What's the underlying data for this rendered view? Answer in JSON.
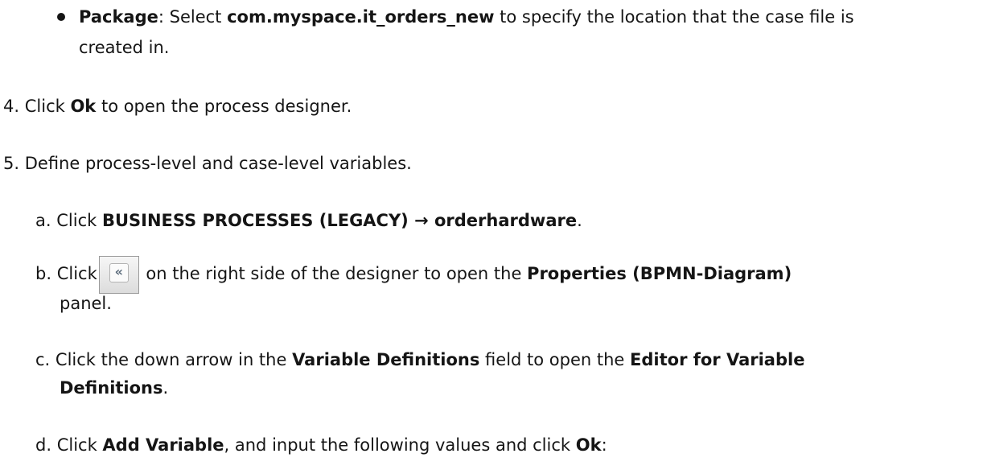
{
  "bullet_package": {
    "label": "Package",
    "text_a": ": Select ",
    "value": "com.myspace.it_orders_new",
    "text_b": " to specify the location that the case file is",
    "text_c": "created in."
  },
  "step4": {
    "number": "4.",
    "text_a": "Click ",
    "button": "Ok",
    "text_b": " to open the process designer."
  },
  "step5": {
    "number": "5.",
    "text": "Define process-level and case-level variables."
  },
  "substep_a": {
    "letter": "a.",
    "text_a": "Click ",
    "menu_path": "BUSINESS PROCESSES (LEGACY) → orderhardware",
    "text_b": "."
  },
  "substep_b": {
    "letter": "b.",
    "text_a": "Click",
    "icon": "double-chevron-left-icon",
    "text_b": " on the right side of the designer to open the ",
    "panel": "Properties (BPMN-Diagram)",
    "text_c": "panel."
  },
  "substep_c": {
    "letter": "c.",
    "text_a": "Click the down arrow in the ",
    "field": "Variable Definitions",
    "text_b": " field to open the  ",
    "editor_a": "Editor for Variable",
    "editor_b": "Definitions",
    "text_c": "."
  },
  "substep_d": {
    "letter": "d.",
    "text_a": "Click ",
    "button": "Add Variable",
    "text_b": ", and input the following values and click  ",
    "ok": "Ok",
    "text_c": ":"
  }
}
